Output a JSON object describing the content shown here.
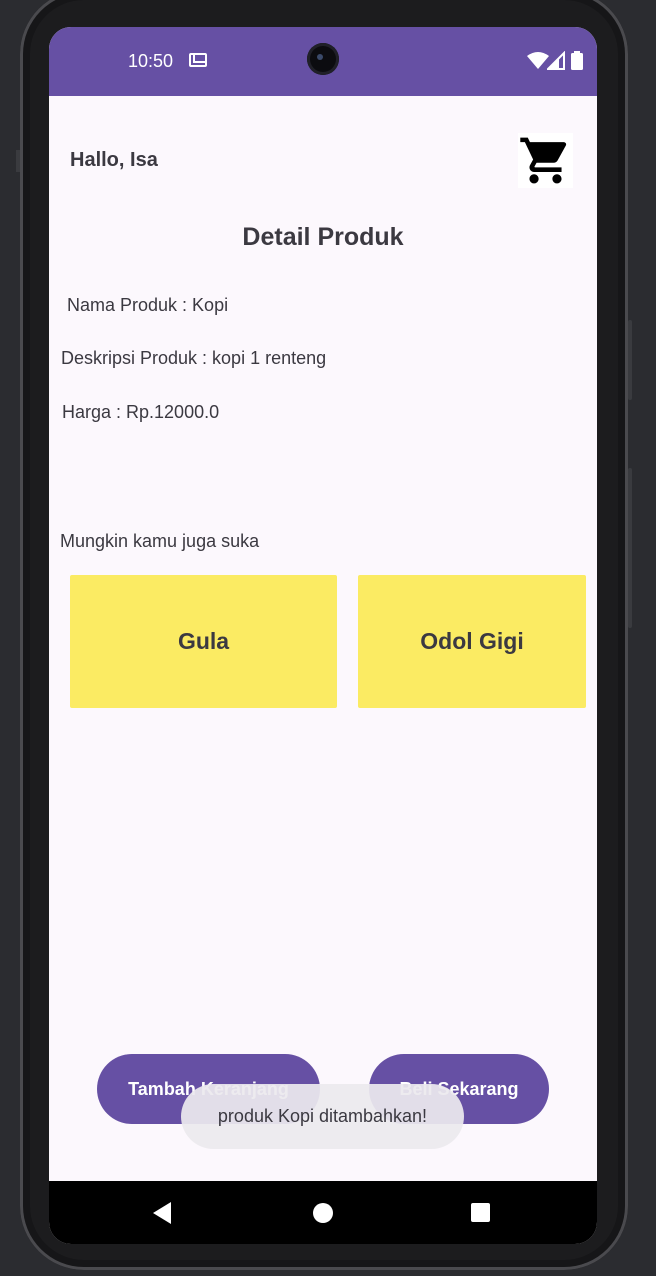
{
  "status_bar": {
    "time": "10:50",
    "icons": [
      "gmail-icon",
      "wifi-icon",
      "signal-icon",
      "battery-icon"
    ],
    "color": "#6650a4"
  },
  "header": {
    "greeting": "Hallo, Isa",
    "cart_icon": "shopping-cart-icon"
  },
  "page": {
    "title": "Detail Produk"
  },
  "product": {
    "name_line": "Nama Produk : Kopi",
    "description_line": "Deskripsi Produk : kopi 1 renteng",
    "price_line": "Harga : Rp.12000.0"
  },
  "suggestions": {
    "label": "Mungkin kamu juga suka",
    "items": [
      {
        "name": "Gula"
      },
      {
        "name": "Odol Gigi"
      }
    ],
    "card_color": "#fbeb63"
  },
  "actions": {
    "add_to_cart": "Tambah Keranjang",
    "buy_now": "Beli Sekarang",
    "button_color": "#6650a4"
  },
  "toast": {
    "message": "produk Kopi ditambahkan!"
  },
  "nav_bar": {
    "icons": [
      "back-icon",
      "home-icon",
      "recents-icon"
    ]
  }
}
